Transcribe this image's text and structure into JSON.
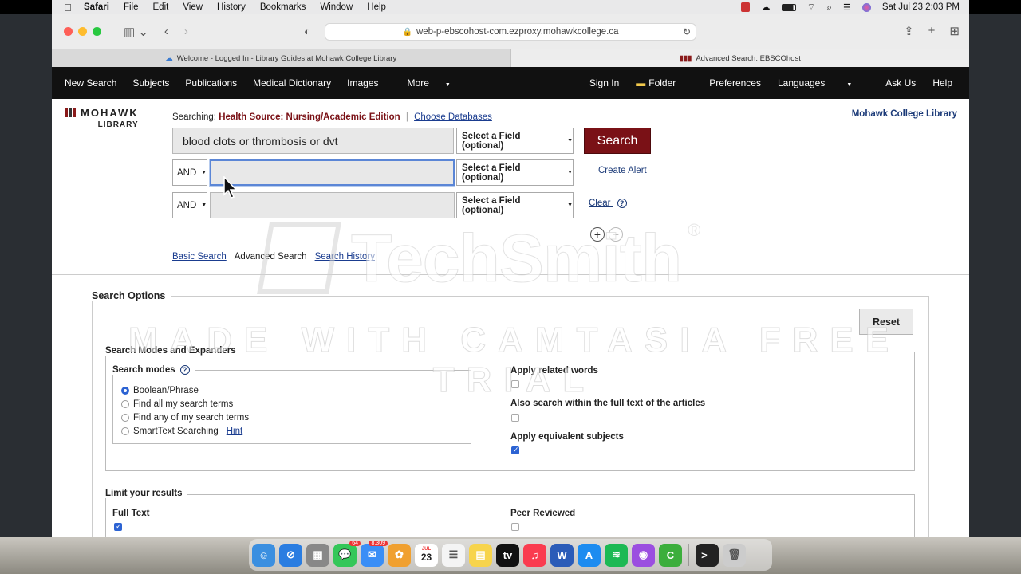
{
  "menubar": {
    "apple": "",
    "app": "Safari",
    "items": [
      "File",
      "Edit",
      "View",
      "History",
      "Bookmarks",
      "Window",
      "Help"
    ],
    "clock": "Sat Jul 23  2:03 PM"
  },
  "browser": {
    "url": "web-p-ebscohost-com.ezproxy.mohawkcollege.ca",
    "tabs": [
      {
        "title": "Welcome - Logged In - Library Guides at Mohawk College Library"
      },
      {
        "title": "Advanced Search: EBSCOhost"
      }
    ]
  },
  "nav": {
    "left": [
      "New Search",
      "Subjects",
      "Publications",
      "Medical Dictionary",
      "Images",
      "More"
    ],
    "right": [
      "Sign In",
      "Folder",
      "Preferences",
      "Languages",
      "Ask Us",
      "Help"
    ]
  },
  "logo": {
    "word": "MOHAWK",
    "sub": "LIBRARY"
  },
  "search": {
    "searching_label": "Searching:",
    "database": "Health Source: Nursing/Academic Edition",
    "choose_db": "Choose Databases",
    "library_name": "Mohawk College Library",
    "row1_value": "blood clots or thrombosis or dvt",
    "row2_value": "",
    "row3_value": "",
    "bool_op": "AND",
    "field_select": "Select a Field (optional)",
    "search_btn": "Search",
    "create_alert": "Create Alert",
    "clear": "Clear",
    "help": "?",
    "basic": "Basic Search",
    "advanced": "Advanced Search",
    "history": "Search History"
  },
  "options": {
    "title": "Search Options",
    "reset": "Reset",
    "modes_expanders": "Search Modes and Expanders",
    "search_modes": "Search modes",
    "modes": [
      "Boolean/Phrase",
      "Find all my search terms",
      "Find any of my search terms",
      "SmartText Searching"
    ],
    "selected_mode": "Boolean/Phrase",
    "hint": "Hint",
    "apply_related": "Apply related words",
    "apply_related_checked": false,
    "full_text_search": "Also search within the full text of the articles",
    "full_text_search_checked": false,
    "equiv_subjects": "Apply equivalent subjects",
    "equiv_subjects_checked": true,
    "limit_title": "Limit your results",
    "full_text": "Full Text",
    "full_text_checked": true,
    "peer_reviewed": "Peer Reviewed",
    "peer_reviewed_checked": false
  },
  "watermark": {
    "brand": "TechSmith",
    "reg": "®",
    "trial": "MADE WITH CAMTASIA FREE TRIAL"
  },
  "dock": {
    "items": [
      {
        "name": "finder",
        "color": "#3b8fe0",
        "glyph": "☺"
      },
      {
        "name": "safari",
        "color": "#2a7de1",
        "glyph": "⊘"
      },
      {
        "name": "launchpad",
        "color": "#888",
        "glyph": "▦"
      },
      {
        "name": "messages",
        "color": "#34c759",
        "glyph": "💬",
        "badge": "64"
      },
      {
        "name": "mail",
        "color": "#3a8ef6",
        "glyph": "✉",
        "badge": "8,309"
      },
      {
        "name": "photos",
        "color": "#f0a030",
        "glyph": "✿"
      },
      {
        "name": "calendar",
        "color": "#fff",
        "glyph": "23",
        "month": "JUL"
      },
      {
        "name": "reminders",
        "color": "#f4f4f4",
        "glyph": "☰"
      },
      {
        "name": "notes",
        "color": "#f7d44c",
        "glyph": "▤"
      },
      {
        "name": "apple-tv",
        "color": "#111",
        "glyph": "tv"
      },
      {
        "name": "music",
        "color": "#fa3c4f",
        "glyph": "♫"
      },
      {
        "name": "word",
        "color": "#2b5cb8",
        "glyph": "W"
      },
      {
        "name": "app-store",
        "color": "#1d8cf0",
        "glyph": "A"
      },
      {
        "name": "spotify",
        "color": "#1db954",
        "glyph": "≋"
      },
      {
        "name": "podcasts",
        "color": "#9b4ee0",
        "glyph": "◉"
      },
      {
        "name": "camtasia",
        "color": "#3cae3c",
        "glyph": "C"
      },
      {
        "name": "terminal",
        "color": "#222",
        "glyph": ">_"
      },
      {
        "name": "trash",
        "color": "#ccc",
        "glyph": "🗑"
      }
    ]
  }
}
